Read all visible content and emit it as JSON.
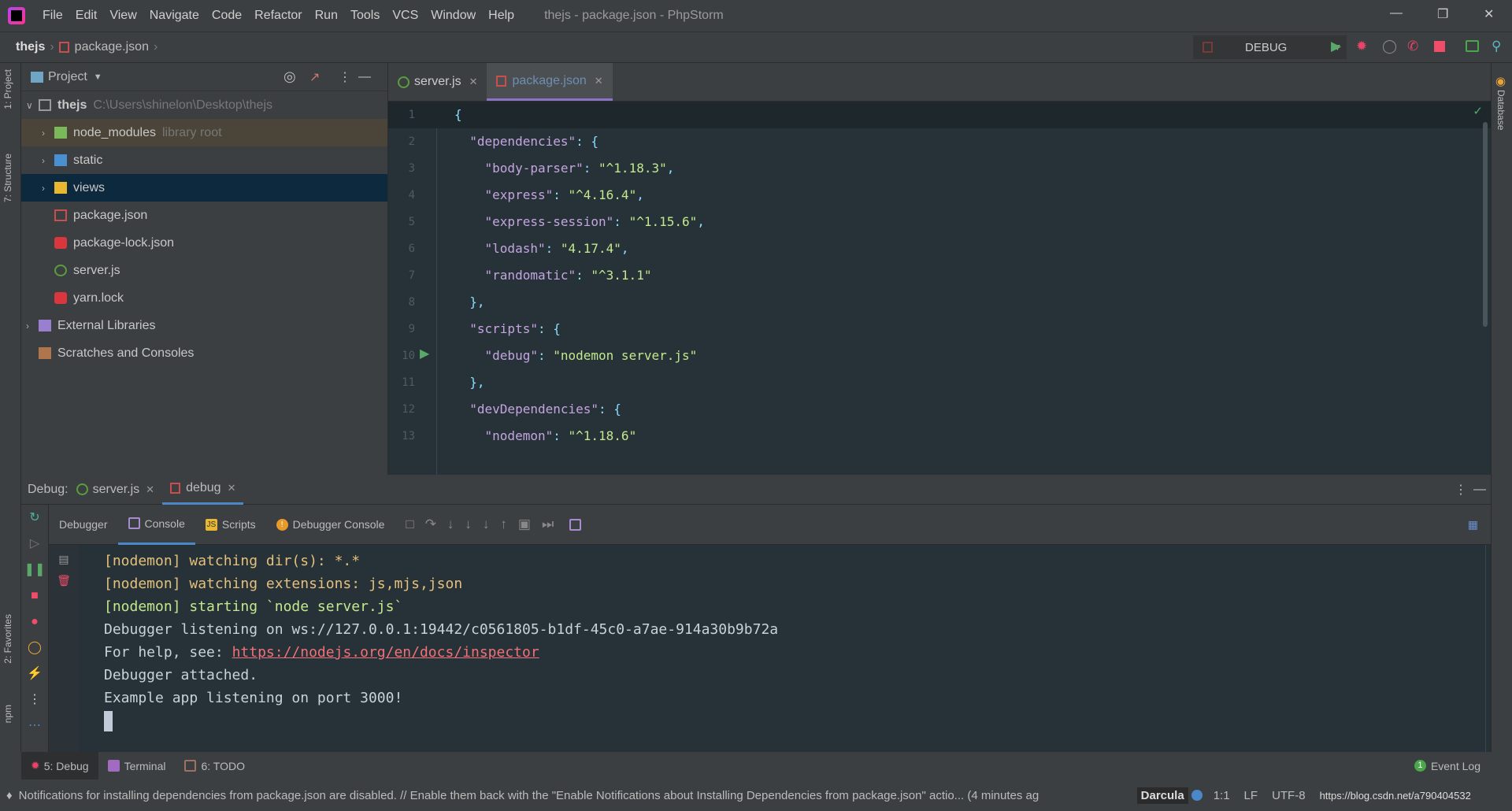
{
  "menubar": {
    "items": [
      "File",
      "Edit",
      "View",
      "Navigate",
      "Code",
      "Refactor",
      "Run",
      "Tools",
      "VCS",
      "Window",
      "Help"
    ],
    "title": "thejs - package.json - PhpStorm"
  },
  "breadcrumb": {
    "project": "thejs",
    "file": "package.json"
  },
  "run_config": {
    "label": "DEBUG"
  },
  "left_strip": {
    "project": "1: Project",
    "structure": "7: Structure",
    "favorites": "2: Favorites",
    "npm": "npm"
  },
  "right_strip": {
    "database": "Database"
  },
  "project": {
    "title": "Project",
    "root": {
      "name": "thejs",
      "path": "C:\\Users\\shinelon\\Desktop\\thejs"
    },
    "items": [
      {
        "name": "node_modules",
        "note": "library root"
      },
      {
        "name": "static"
      },
      {
        "name": "views"
      },
      {
        "name": "package.json"
      },
      {
        "name": "package-lock.json"
      },
      {
        "name": "server.js"
      },
      {
        "name": "yarn.lock"
      }
    ],
    "external": "External Libraries",
    "scratches": "Scratches and Consoles"
  },
  "editor": {
    "tabs": [
      {
        "label": "server.js"
      },
      {
        "label": "package.json",
        "active": true
      }
    ],
    "lines": [
      {
        "n": "1",
        "parts": [
          [
            "p",
            "{"
          ]
        ]
      },
      {
        "n": "2",
        "parts": [
          [
            "k",
            "  \"dependencies\""
          ],
          [
            "p",
            ": {"
          ]
        ]
      },
      {
        "n": "3",
        "parts": [
          [
            "k",
            "    \"body-parser\""
          ],
          [
            "p",
            ": "
          ],
          [
            "v",
            "\"^1.18.3\""
          ],
          [
            "p",
            ","
          ]
        ]
      },
      {
        "n": "4",
        "parts": [
          [
            "k",
            "    \"express\""
          ],
          [
            "p",
            ": "
          ],
          [
            "v",
            "\"^4.16.4\""
          ],
          [
            "p",
            ","
          ]
        ]
      },
      {
        "n": "5",
        "parts": [
          [
            "k",
            "    \"express-session\""
          ],
          [
            "p",
            ": "
          ],
          [
            "v",
            "\"^1.15.6\""
          ],
          [
            "p",
            ","
          ]
        ]
      },
      {
        "n": "6",
        "parts": [
          [
            "k",
            "    \"lodash\""
          ],
          [
            "p",
            ": "
          ],
          [
            "v",
            "\"4.17.4\""
          ],
          [
            "p",
            ","
          ]
        ]
      },
      {
        "n": "7",
        "parts": [
          [
            "k",
            "    \"randomatic\""
          ],
          [
            "p",
            ": "
          ],
          [
            "v",
            "\"^3.1.1\""
          ]
        ]
      },
      {
        "n": "8",
        "parts": [
          [
            "p",
            "  },"
          ]
        ]
      },
      {
        "n": "9",
        "parts": [
          [
            "k",
            "  \"scripts\""
          ],
          [
            "p",
            ": {"
          ]
        ]
      },
      {
        "n": "10",
        "parts": [
          [
            "k",
            "    \"debug\""
          ],
          [
            "p",
            ": "
          ],
          [
            "v",
            "\"nodemon server.js\""
          ]
        ]
      },
      {
        "n": "11",
        "parts": [
          [
            "p",
            "  },"
          ]
        ]
      },
      {
        "n": "12",
        "parts": [
          [
            "k",
            "  \"devDependencies\""
          ],
          [
            "p",
            ": {"
          ]
        ]
      },
      {
        "n": "13",
        "parts": [
          [
            "k",
            "    \"nodemon\""
          ],
          [
            "p",
            ": "
          ],
          [
            "v",
            "\"^1.18.6\""
          ]
        ]
      }
    ]
  },
  "debug": {
    "label": "Debug:",
    "tabs": [
      {
        "label": "server.js"
      },
      {
        "label": "debug",
        "active": true
      }
    ],
    "toolbar": {
      "debugger": "Debugger",
      "console": "Console",
      "scripts": "Scripts",
      "debugger_console": "Debugger Console"
    },
    "console": [
      {
        "style": "yel",
        "text": "[nodemon] watching dir(s): *.*"
      },
      {
        "style": "yel",
        "text": "[nodemon] watching extensions: js,mjs,json"
      },
      {
        "style": "grn",
        "text": "[nodemon] starting `node server.js`"
      },
      {
        "style": "wht",
        "text": "Debugger listening on ws://127.0.0.1:19442/c0561805-b1df-45c0-a7ae-914a30b9b72a"
      },
      {
        "style": "wht",
        "text": "For help, see: ",
        "link": "https://nodejs.org/en/docs/inspector"
      },
      {
        "style": "wht",
        "text": "Debugger attached."
      },
      {
        "style": "wht",
        "text": "Example app listening on port 3000!"
      }
    ]
  },
  "bottom_tabs": [
    {
      "label": "5: Debug",
      "active": true
    },
    {
      "label": "Terminal"
    },
    {
      "label": "6: TODO"
    }
  ],
  "event_log": {
    "label": "Event Log",
    "count": "1"
  },
  "status": {
    "message": "Notifications for installing dependencies from package.json are disabled. // Enable them back with the \"Enable Notifications about Installing Dependencies from package.json\" actio... (4 minutes ag",
    "theme": "Darcula",
    "position": "1:1",
    "line_sep": "LF",
    "encoding": "UTF-8",
    "watermark": "https://blog.csdn.net/a790404532"
  },
  "colors": {
    "editor_bg": "#263238",
    "key": "#c5a5e0",
    "value": "#c3e88d",
    "punct": "#89ddff",
    "accent": "#4a88c7"
  }
}
